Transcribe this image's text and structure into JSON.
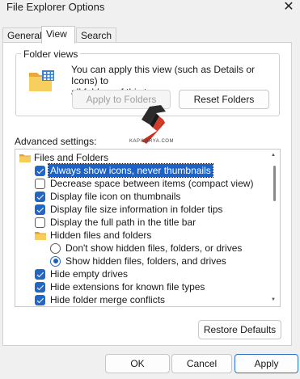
{
  "window": {
    "title": "File Explorer Options",
    "close_glyph": "✕"
  },
  "tabs": [
    {
      "label": "General",
      "active": false
    },
    {
      "label": "View",
      "active": true
    },
    {
      "label": "Search",
      "active": false
    }
  ],
  "folder_views": {
    "heading": "Folder views",
    "description_line1": "You can apply this view (such as Details or Icons) to",
    "description_line2": "all folders of this type.",
    "apply_label": "Apply to Folders",
    "reset_label": "Reset Folders"
  },
  "watermark": {
    "text": "KAPILARYA.COM"
  },
  "advanced": {
    "heading": "Advanced settings:",
    "items": [
      {
        "kind": "folder",
        "label": "Files and Folders"
      },
      {
        "kind": "checkbox",
        "checked": true,
        "selected": true,
        "label": "Always show icons, never thumbnails"
      },
      {
        "kind": "checkbox",
        "checked": false,
        "label": "Decrease space between items (compact view)"
      },
      {
        "kind": "checkbox",
        "checked": true,
        "label": "Display file icon on thumbnails"
      },
      {
        "kind": "checkbox",
        "checked": true,
        "label": "Display file size information in folder tips"
      },
      {
        "kind": "checkbox",
        "checked": false,
        "label": "Display the full path in the title bar"
      },
      {
        "kind": "folder",
        "label": "Hidden files and folders"
      },
      {
        "kind": "radio",
        "checked": false,
        "label": "Don't show hidden files, folders, or drives"
      },
      {
        "kind": "radio",
        "checked": true,
        "label": "Show hidden files, folders, and drives"
      },
      {
        "kind": "checkbox",
        "checked": true,
        "label": "Hide empty drives"
      },
      {
        "kind": "checkbox",
        "checked": true,
        "label": "Hide extensions for known file types"
      },
      {
        "kind": "checkbox",
        "checked": true,
        "label": "Hide folder merge conflicts"
      }
    ],
    "restore_label": "Restore Defaults"
  },
  "footer": {
    "ok_label": "OK",
    "cancel_label": "Cancel",
    "apply_label": "Apply"
  },
  "colors": {
    "accent": "#2167c6",
    "selection": "#1d63c7",
    "folder": "#f2c14e"
  }
}
